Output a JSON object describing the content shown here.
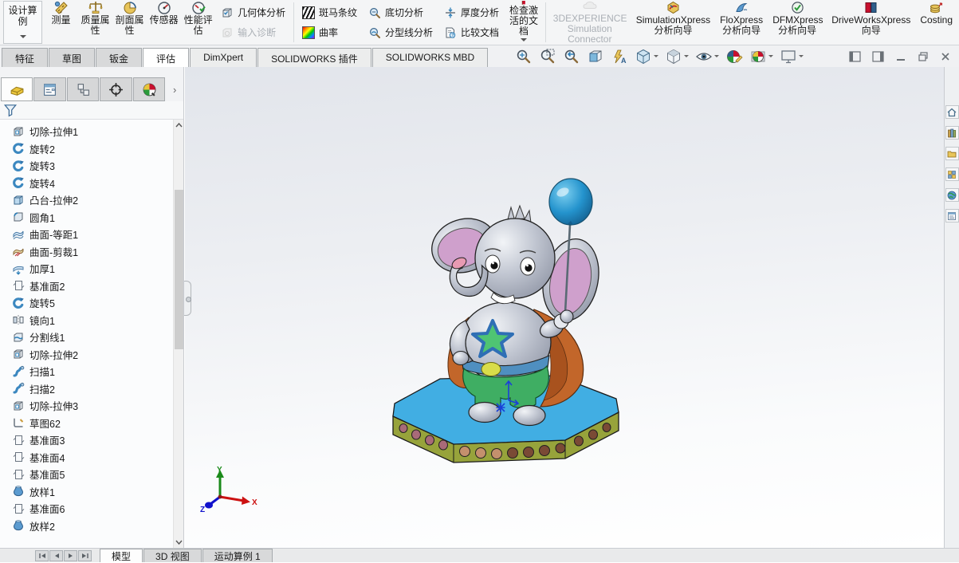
{
  "ribbon": {
    "design_study_label": "设计算例",
    "large": [
      {
        "label": "测量",
        "icon": "measure-icon"
      },
      {
        "label": "质量属性",
        "icon": "mass-properties-icon"
      },
      {
        "label": "剖面属性",
        "icon": "section-properties-icon"
      },
      {
        "label": "传感器",
        "icon": "sensor-icon"
      },
      {
        "label": "性能评估",
        "icon": "performance-evaluation-icon"
      }
    ],
    "pairs": [
      [
        {
          "label": "几何体分析",
          "disabled": false
        },
        {
          "label": "输入诊断",
          "disabled": true
        }
      ],
      [
        {
          "label": "斑马条纹",
          "disabled": false
        },
        {
          "label": "曲率",
          "disabled": false
        }
      ],
      [
        {
          "label": "底切分析",
          "disabled": false
        },
        {
          "label": "分型线分析",
          "disabled": false
        }
      ],
      [
        {
          "label": "厚度分析",
          "disabled": false
        },
        {
          "label": "比较文档",
          "disabled": false
        }
      ]
    ],
    "check_active_docs_label": "检查激活的文档",
    "xpress": [
      {
        "label": "3DEXPERIENCE Simulation Connector",
        "disabled": true
      },
      {
        "label": "SimulationXpress 分析向导",
        "disabled": false
      },
      {
        "label": "FloXpress 分析向导",
        "disabled": false
      },
      {
        "label": "DFMXpress 分析向导",
        "disabled": false
      },
      {
        "label": "DriveWorksXpress 向导",
        "disabled": false
      },
      {
        "label": "Costing",
        "disabled": false
      }
    ]
  },
  "command_tabs": {
    "active": "评估",
    "items": [
      {
        "label": "特征"
      },
      {
        "label": "草图"
      },
      {
        "label": "钣金"
      },
      {
        "label": "评估"
      },
      {
        "label": "DimXpert"
      },
      {
        "label": "SOLIDWORKS 插件"
      },
      {
        "label": "SOLIDWORKS MBD"
      }
    ]
  },
  "headsup_toolbar": [
    {
      "name": "zoom-to-fit"
    },
    {
      "name": "zoom-to-area"
    },
    {
      "name": "previous-view"
    },
    {
      "name": "section-view"
    },
    {
      "name": "annotation-view"
    },
    {
      "name": "view-orientation",
      "dropdown": true
    },
    {
      "name": "display-style",
      "dropdown": true
    },
    {
      "name": "hide-show-items",
      "dropdown": true
    },
    {
      "name": "edit-appearance"
    },
    {
      "name": "apply-scene",
      "dropdown": true
    },
    {
      "name": "view-settings",
      "dropdown": true
    }
  ],
  "window_controls": [
    "pane-left",
    "pane-right",
    "minimize",
    "restore",
    "close"
  ],
  "left_panel": {
    "tabs": [
      "featuremanager-design-tree",
      "propertymanager",
      "configurationmanager",
      "dimxpertmanager",
      "displaymanager"
    ],
    "tree_items": [
      {
        "label": "切除-拉伸1",
        "icon": "cut-extrude"
      },
      {
        "label": "旋转2",
        "icon": "revolve"
      },
      {
        "label": "旋转3",
        "icon": "revolve"
      },
      {
        "label": "旋转4",
        "icon": "revolve"
      },
      {
        "label": "凸台-拉伸2",
        "icon": "boss-extrude"
      },
      {
        "label": "圆角1",
        "icon": "fillet"
      },
      {
        "label": "曲面-等距1",
        "icon": "surface-offset"
      },
      {
        "label": "曲面-剪裁1",
        "icon": "surface-trim"
      },
      {
        "label": "加厚1",
        "icon": "thicken"
      },
      {
        "label": "基准面2",
        "icon": "plane"
      },
      {
        "label": "旋转5",
        "icon": "revolve"
      },
      {
        "label": "镜向1",
        "icon": "mirror"
      },
      {
        "label": "分割线1",
        "icon": "split-line"
      },
      {
        "label": "切除-拉伸2",
        "icon": "cut-extrude"
      },
      {
        "label": "扫描1",
        "icon": "sweep"
      },
      {
        "label": "扫描2",
        "icon": "sweep"
      },
      {
        "label": "切除-拉伸3",
        "icon": "cut-extrude"
      },
      {
        "label": "草图62",
        "icon": "sketch"
      },
      {
        "label": "基准面3",
        "icon": "plane"
      },
      {
        "label": "基准面4",
        "icon": "plane"
      },
      {
        "label": "基准面5",
        "icon": "plane"
      },
      {
        "label": "放样1",
        "icon": "loft"
      },
      {
        "label": "基准面6",
        "icon": "plane"
      },
      {
        "label": "放样2",
        "icon": "loft"
      }
    ]
  },
  "task_pane_icons": [
    "resources-home-icon",
    "design-library-icon",
    "file-explorer-icon",
    "view-palette-icon",
    "appearances-icon",
    "custom-properties-icon"
  ],
  "bottom": {
    "active": "模型",
    "tabs": [
      {
        "label": "模型"
      },
      {
        "label": "3D 视图"
      },
      {
        "label": "运动算例 1"
      }
    ]
  },
  "triad": {
    "x": "X",
    "y": "Y",
    "z": "Z"
  },
  "colors": {
    "balloon": "#2493cd",
    "platformTop": "#41aee3",
    "platformSide": "#97a33b",
    "cape": "#c2662a",
    "star": "#4fc473",
    "starOutline": "#2f6fb5",
    "belt": "#4f8fc0",
    "shorts": "#3fae63",
    "buckle": "#d9dd4a",
    "earInner": "#cfa0cc",
    "circleTan": "#c4906d",
    "circleBrown": "#7a4a35",
    "circleMauve": "#a86a78"
  }
}
